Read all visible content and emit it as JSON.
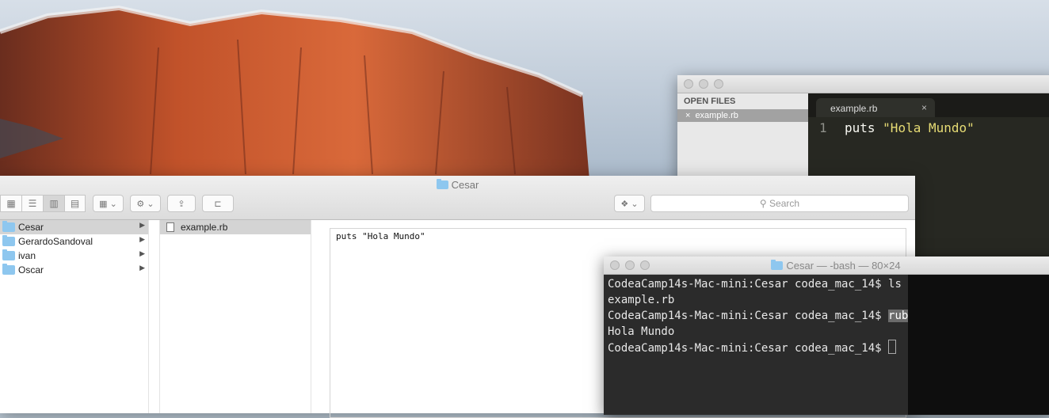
{
  "sublime": {
    "sidebar_header": "OPEN FILES",
    "open_file": "example.rb",
    "tab_label": "example.rb",
    "tab_close": "×",
    "line_number": "1",
    "code_keyword": "puts ",
    "code_string": "\"Hola Mundo\""
  },
  "finder": {
    "title": "Cesar",
    "search_placeholder": "Search",
    "folders": [
      {
        "label": "Cesar"
      },
      {
        "label": "GerardoSandoval"
      },
      {
        "label": "ivan"
      },
      {
        "label": "Oscar"
      }
    ],
    "files": [
      {
        "label": "example.rb"
      }
    ],
    "preview_text": "puts \"Hola Mundo\""
  },
  "terminal": {
    "title": "Cesar — -bash — 80×24",
    "lines": [
      {
        "prompt": "CodeaCamp14s-Mac-mini:Cesar codea_mac_14$ ",
        "cmd": "ls"
      },
      {
        "output": "example.rb"
      },
      {
        "prompt": "CodeaCamp14s-Mac-mini:Cesar codea_mac_14$ ",
        "cmd": "ruby example.rb"
      },
      {
        "output": "Hola Mundo"
      },
      {
        "prompt": "CodeaCamp14s-Mac-mini:Cesar codea_mac_14$ "
      }
    ]
  },
  "colors": {
    "editor_bg": "#272822",
    "string": "#e6db74",
    "folder": "#8ec7ef"
  }
}
